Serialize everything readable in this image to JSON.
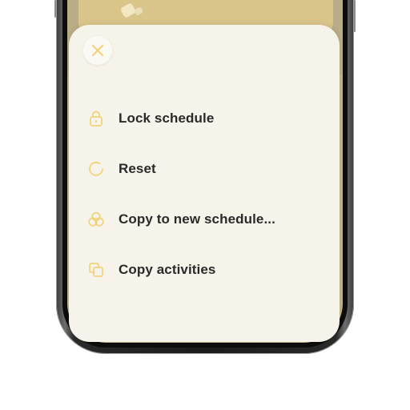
{
  "sheet": {
    "close_icon": "close-icon",
    "menu_items": [
      {
        "label": "Lock schedule",
        "icon": "lock-icon"
      },
      {
        "label": "Reset",
        "icon": "reset-icon"
      },
      {
        "label": "Copy to new schedule...",
        "icon": "copy-to-new-icon"
      },
      {
        "label": "Copy activities",
        "icon": "copy-activities-icon"
      }
    ]
  },
  "colors": {
    "accent": "#f2d27a",
    "sheet_background": "#f6f3ea",
    "label_text": "#2a2a2a",
    "phone_frame": "#1b1b1b"
  }
}
